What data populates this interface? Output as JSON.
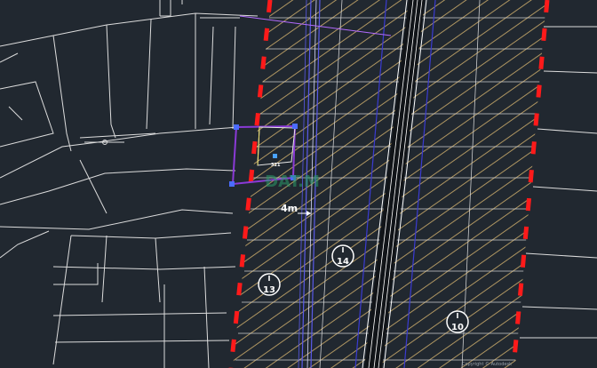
{
  "drawing": {
    "dimension_label": "4m",
    "zone_labels": [
      {
        "id": "13",
        "symbol": "I",
        "number": "13"
      },
      {
        "id": "14",
        "symbol": "I",
        "number": "14"
      },
      {
        "id": "10",
        "symbol": "I",
        "number": "10"
      }
    ],
    "selected_parcel_label": "321",
    "colors": {
      "background": "#212830",
      "boundary_dash": "#ff1a1a",
      "hatch": "#c8a96a",
      "road": "#3b3bd1",
      "selection": "#4a6cff",
      "selection_box": "#8a3ad6",
      "parcel_outline": "#e6e6e6"
    }
  },
  "statusbar": {
    "text": "Copyright © Autodesk"
  }
}
